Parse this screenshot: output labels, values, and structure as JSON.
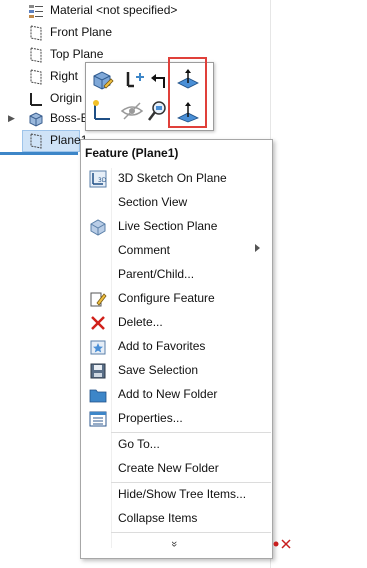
{
  "tree": {
    "items": [
      {
        "label": "Material <not specified>",
        "icon": "material-icon"
      },
      {
        "label": "Front Plane",
        "icon": "plane-icon"
      },
      {
        "label": "Top Plane",
        "icon": "plane-icon"
      },
      {
        "label": "Right",
        "icon": "plane-icon"
      },
      {
        "label": "Origin",
        "icon": "origin-icon"
      },
      {
        "label": "Boss-E",
        "icon": "boss-extrude-icon"
      },
      {
        "label": "Plane1",
        "icon": "plane-icon"
      }
    ]
  },
  "toolbar": {
    "buttons": [
      "edit-feature-icon",
      "suppress-sketch-icon",
      "rollback-icon",
      "normal-to-icon",
      "sketch-on-plane-icon",
      "hide-icon",
      "zoom-to-selection-icon",
      "show-plane-icon"
    ]
  },
  "menu": {
    "title": "Feature (Plane1)",
    "items": [
      {
        "label": "3D Sketch On Plane",
        "icon": "3d-sketch-icon"
      },
      {
        "label": "Section View",
        "icon": ""
      },
      {
        "label": "Live Section Plane",
        "icon": "live-section-icon"
      },
      {
        "label": "Comment",
        "icon": "",
        "submenu": true
      },
      {
        "label": "Parent/Child...",
        "icon": ""
      },
      {
        "label": "Configure Feature",
        "icon": "configure-icon"
      },
      {
        "label": "Delete...",
        "icon": "delete-icon"
      },
      {
        "label": "Add to Favorites",
        "icon": "favorites-icon"
      },
      {
        "label": "Save Selection",
        "icon": "save-selection-icon"
      },
      {
        "label": "Add to New Folder",
        "icon": "folder-icon"
      },
      {
        "label": "Properties...",
        "icon": "properties-icon"
      },
      {
        "label": "Go To...",
        "icon": ""
      },
      {
        "label": "Create New Folder",
        "icon": ""
      },
      {
        "label": "Hide/Show Tree Items...",
        "icon": ""
      },
      {
        "label": "Collapse Items",
        "icon": ""
      }
    ],
    "expand_glyph": "»"
  },
  "colors": {
    "selection_fill": "#cfe3f7",
    "highlight_box": "#e0403a",
    "accent_blue": "#3d86c8"
  }
}
